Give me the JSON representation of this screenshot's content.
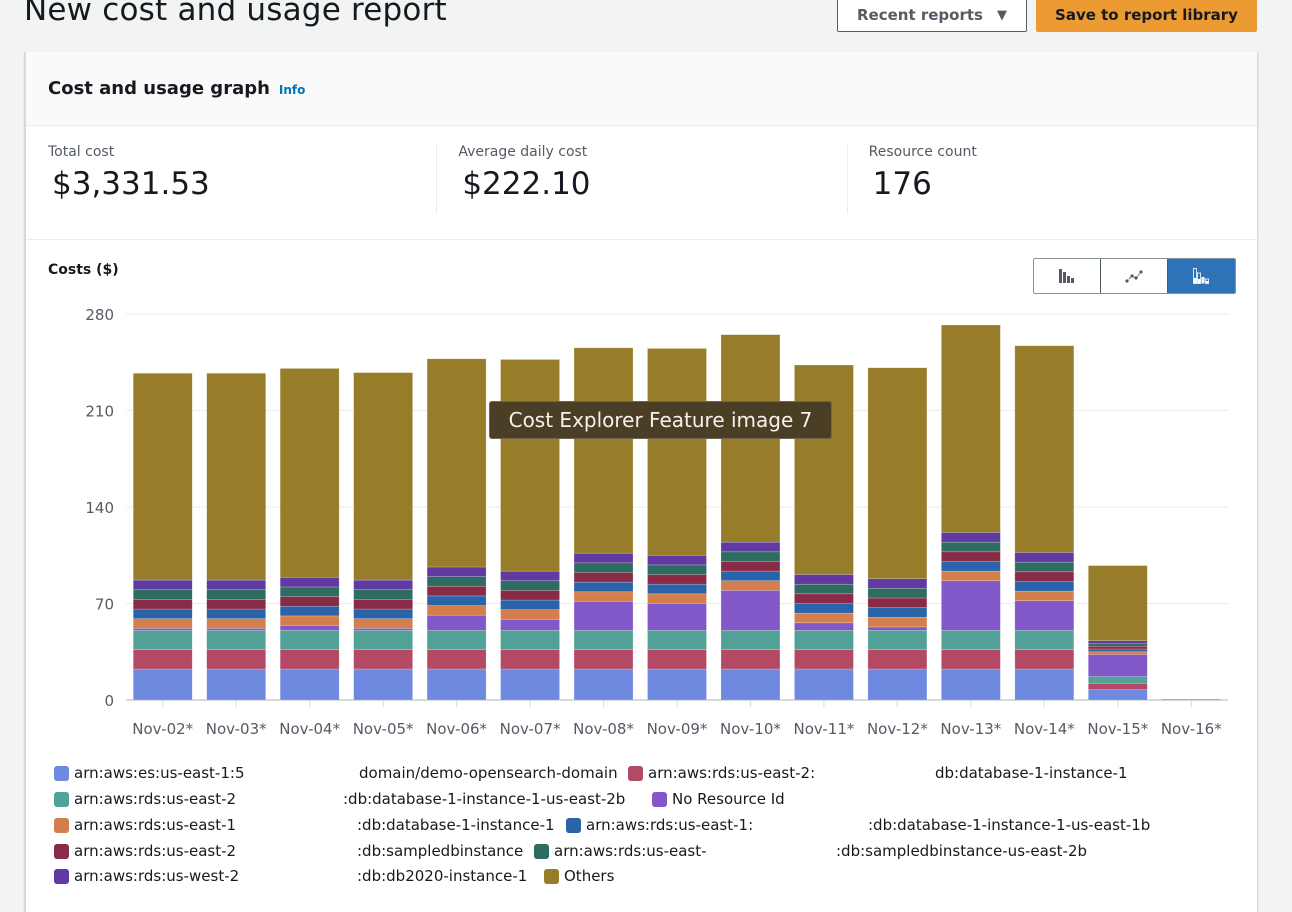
{
  "header": {
    "title": "New cost and usage report",
    "recent_reports_label": "Recent reports",
    "recent_reports_icon": "caret-down-icon",
    "save_label": "Save to report library"
  },
  "card": {
    "title": "Cost and usage graph",
    "info_label": "Info"
  },
  "metrics": [
    {
      "label": "Total cost",
      "value": "$3,331.53"
    },
    {
      "label": "Average daily cost",
      "value": "$222.10"
    },
    {
      "label": "Resource count",
      "value": "176"
    }
  ],
  "chart_toggle": {
    "options": [
      {
        "name": "bar-chart",
        "icon": "bar-chart-icon",
        "active": false
      },
      {
        "name": "line-chart",
        "icon": "line-chart-icon",
        "active": false
      },
      {
        "name": "stacked-bar-chart",
        "icon": "stacked-bar-chart-icon",
        "active": true
      }
    ]
  },
  "tooltip": {
    "text": "Cost Explorer Feature image 7"
  },
  "chart_data": {
    "type": "bar",
    "stacked": true,
    "title": "",
    "ylabel": "Costs ($)",
    "xlabel": "",
    "ylim": [
      0,
      280
    ],
    "yticks": [
      0,
      70,
      140,
      210,
      280
    ],
    "grid": true,
    "legend_position": "bottom",
    "categories": [
      "Nov-02*",
      "Nov-03*",
      "Nov-04*",
      "Nov-05*",
      "Nov-06*",
      "Nov-07*",
      "Nov-08*",
      "Nov-09*",
      "Nov-10*",
      "Nov-11*",
      "Nov-12*",
      "Nov-13*",
      "Nov-14*",
      "Nov-15*",
      "Nov-16*"
    ],
    "series": [
      {
        "name": "arn:aws:es:us-east-1:5 … domain/demo-opensearch-domain",
        "color": "#6f88e0",
        "values": [
          22.5,
          22.5,
          22.5,
          22.5,
          22.5,
          22.5,
          22.5,
          22.5,
          22.5,
          22.5,
          22.5,
          22.5,
          22.5,
          7.5,
          0
        ]
      },
      {
        "name": "arn:aws:rds:us-east-2: … db:database-1-instance-1",
        "color": "#b44966",
        "values": [
          14,
          14,
          14,
          14,
          14,
          14,
          14,
          14,
          14,
          14,
          14,
          14,
          14,
          4.5,
          0
        ]
      },
      {
        "name": "arn:aws:rds:us-east-2 … :db:database-1-instance-1-us-east-2b",
        "color": "#52a196",
        "values": [
          14,
          14,
          14,
          14,
          14,
          14,
          14,
          14,
          14,
          14,
          14,
          14,
          14,
          5,
          0
        ]
      },
      {
        "name": "No Resource Id",
        "color": "#8258c9",
        "values": [
          1.5,
          1.5,
          3.5,
          1.5,
          11,
          8,
          21,
          19.5,
          29,
          5.5,
          2.5,
          36,
          21.5,
          16,
          0.5
        ]
      },
      {
        "name": "arn:aws:rds:us-east-1 … :db:database-1-instance-1",
        "color": "#d47e4c",
        "values": [
          7,
          7,
          7,
          7,
          7,
          7,
          7,
          7,
          7,
          7,
          7,
          7,
          7,
          2,
          0
        ]
      },
      {
        "name": "arn:aws:rds:us-east-1: … :db:database-1-instance-1-us-east-1b",
        "color": "#2a63a8",
        "values": [
          7,
          7,
          7,
          7,
          7,
          7,
          7,
          7,
          7,
          7,
          7,
          7,
          7,
          2,
          0
        ]
      },
      {
        "name": "arn:aws:rds:us-east-2 … :db:sampledbinstance",
        "color": "#892a46",
        "values": [
          7,
          7,
          7,
          7,
          7,
          7,
          7,
          7,
          7,
          7,
          7,
          7,
          7,
          2,
          0
        ]
      },
      {
        "name": "arn:aws:rds:us-east- … :db:sampledbinstance-us-east-2b",
        "color": "#2e6c62",
        "values": [
          7,
          7,
          7,
          7,
          7,
          7,
          7,
          7,
          7,
          7,
          7,
          7,
          7,
          2,
          0
        ]
      },
      {
        "name": "arn:aws:rds:us-west-2 … :db:db2020-instance-1",
        "color": "#603aa0",
        "values": [
          7,
          7,
          7,
          7,
          7,
          7,
          7,
          7,
          7,
          7,
          7,
          7,
          7,
          2,
          0
        ]
      },
      {
        "name": "Others",
        "color": "#977c2a",
        "values": [
          150,
          150,
          151.5,
          150.5,
          151,
          153.5,
          149,
          150,
          150.5,
          152,
          153,
          150.5,
          150,
          54.5,
          0
        ]
      }
    ]
  },
  "legend": [
    {
      "prefix": "arn:aws:es:us-east-1:5",
      "suffix": "domain/demo-opensearch-domain",
      "color": "#6f88e0"
    },
    {
      "prefix": "arn:aws:rds:us-east-2:",
      "suffix": "db:database-1-instance-1",
      "color": "#b44966"
    },
    {
      "prefix": "arn:aws:rds:us-east-2",
      "suffix": ":db:database-1-instance-1-us-east-2b",
      "color": "#52a196"
    },
    {
      "prefix": "No Resource Id",
      "suffix": "",
      "color": "#8258c9"
    },
    {
      "prefix": "arn:aws:rds:us-east-1",
      "suffix": ":db:database-1-instance-1",
      "color": "#d47e4c"
    },
    {
      "prefix": "arn:aws:rds:us-east-1:",
      "suffix": ":db:database-1-instance-1-us-east-1b",
      "color": "#2a63a8"
    },
    {
      "prefix": "arn:aws:rds:us-east-2",
      "suffix": ":db:sampledbinstance",
      "color": "#892a46"
    },
    {
      "prefix": "arn:aws:rds:us-east-",
      "suffix": ":db:sampledbinstance-us-east-2b",
      "color": "#2e6c62"
    },
    {
      "prefix": "arn:aws:rds:us-west-2",
      "suffix": ":db:db2020-instance-1",
      "color": "#603aa0"
    },
    {
      "prefix": "Others",
      "suffix": "",
      "color": "#977c2a"
    }
  ]
}
